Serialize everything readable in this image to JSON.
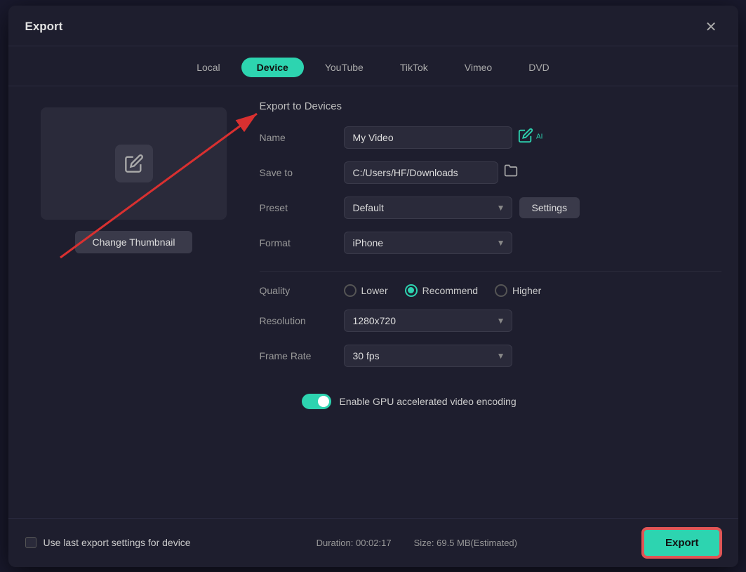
{
  "dialog": {
    "title": "Export",
    "close_label": "✕"
  },
  "tabs": {
    "items": [
      {
        "id": "local",
        "label": "Local",
        "active": false
      },
      {
        "id": "device",
        "label": "Device",
        "active": true
      },
      {
        "id": "youtube",
        "label": "YouTube",
        "active": false
      },
      {
        "id": "tiktok",
        "label": "TikTok",
        "active": false
      },
      {
        "id": "vimeo",
        "label": "Vimeo",
        "active": false
      },
      {
        "id": "dvd",
        "label": "DVD",
        "active": false
      }
    ]
  },
  "thumbnail": {
    "change_label": "Change Thumbnail"
  },
  "export_form": {
    "section_title": "Export to Devices",
    "name_label": "Name",
    "name_value": "My Video",
    "save_to_label": "Save to",
    "save_to_value": "C:/Users/HF/Downloads",
    "preset_label": "Preset",
    "preset_value": "Default",
    "settings_label": "Settings",
    "format_label": "Format",
    "format_value": "iPhone",
    "quality_label": "Quality",
    "quality_options": [
      {
        "id": "lower",
        "label": "Lower",
        "selected": false
      },
      {
        "id": "recommend",
        "label": "Recommend",
        "selected": true
      },
      {
        "id": "higher",
        "label": "Higher",
        "selected": false
      }
    ],
    "resolution_label": "Resolution",
    "resolution_value": "1280x720",
    "frame_rate_label": "Frame Rate",
    "frame_rate_value": "30 fps",
    "gpu_label": "Enable GPU accelerated video encoding"
  },
  "footer": {
    "use_last_settings_label": "Use last export settings for device",
    "duration_label": "Duration:",
    "duration_value": "00:02:17",
    "size_label": "Size:",
    "size_value": "69.5 MB(Estimated)",
    "export_label": "Export"
  },
  "colors": {
    "accent": "#2dd4b0",
    "arrow": "#d93030"
  }
}
